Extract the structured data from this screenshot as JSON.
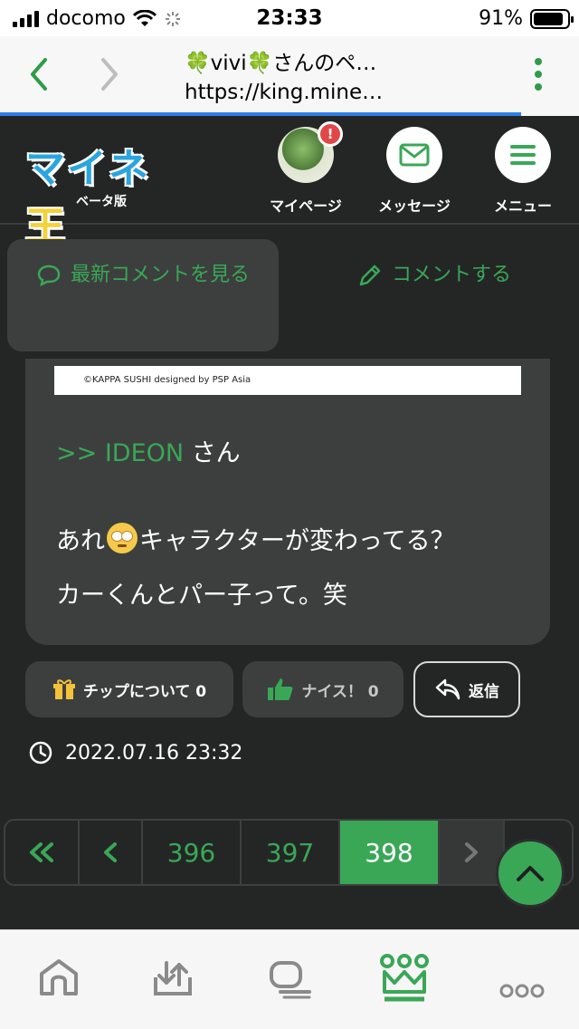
{
  "status_bar": {
    "carrier": "docomo",
    "time": "23:33",
    "battery": "91%"
  },
  "browser": {
    "title": "🍀vivi🍀さんのペ…",
    "url": "https://king.mine…"
  },
  "header": {
    "logo_text": "マイネ",
    "logo_king": "王",
    "logo_sub": "ベータ版",
    "nav": {
      "mypage": "マイページ",
      "message": "メッセージ",
      "menu": "メニュー"
    },
    "notification_badge": "!"
  },
  "tabs": {
    "latest": "最新コメントを見る",
    "comment": "コメントする"
  },
  "comment": {
    "image_credit": "©KAPPA SUSHI designed by PSP Asia",
    "mention_link": ">> IDEON",
    "mention_suffix": " さん",
    "line1_before": "あれ",
    "line1_after": "キャラクターが変わってる？",
    "line2": "カーくんとパー子って。笑"
  },
  "actions": {
    "tip": "チップについて 0",
    "nice": "ナイス！ 0",
    "reply": "返信"
  },
  "timestamp": "2022.07.16 23:32",
  "pager": {
    "pages": [
      "396",
      "397",
      "398"
    ],
    "current": "398"
  },
  "colors": {
    "accent": "#3aa757",
    "background": "#242625",
    "card": "#3c3f3e"
  }
}
